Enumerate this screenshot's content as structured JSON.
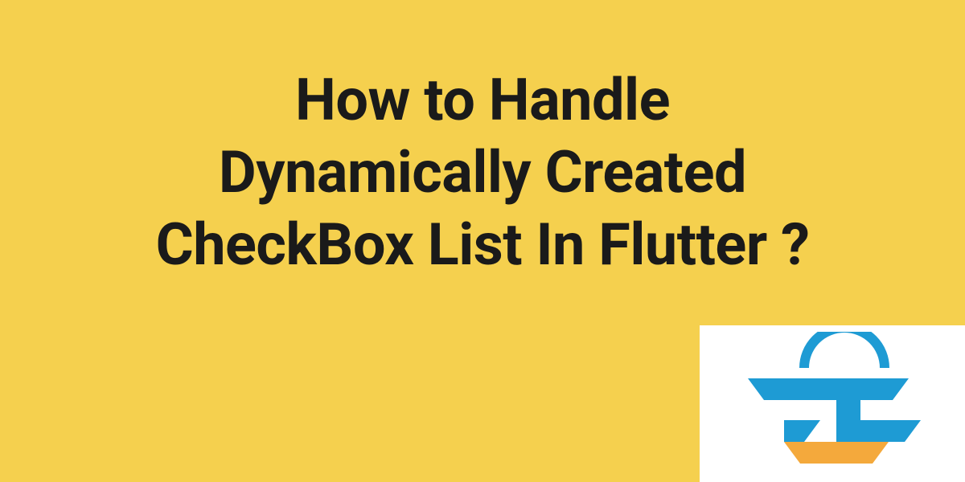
{
  "title": {
    "line1": "How to Handle",
    "line2": "Dynamically Created",
    "line3": "CheckBox List In Flutter ?"
  },
  "colors": {
    "background": "#f5d04e",
    "text": "#1a1a1a",
    "logo_blue": "#1e9bd4",
    "logo_orange": "#f4a93c",
    "logo_white": "#ffffff"
  }
}
